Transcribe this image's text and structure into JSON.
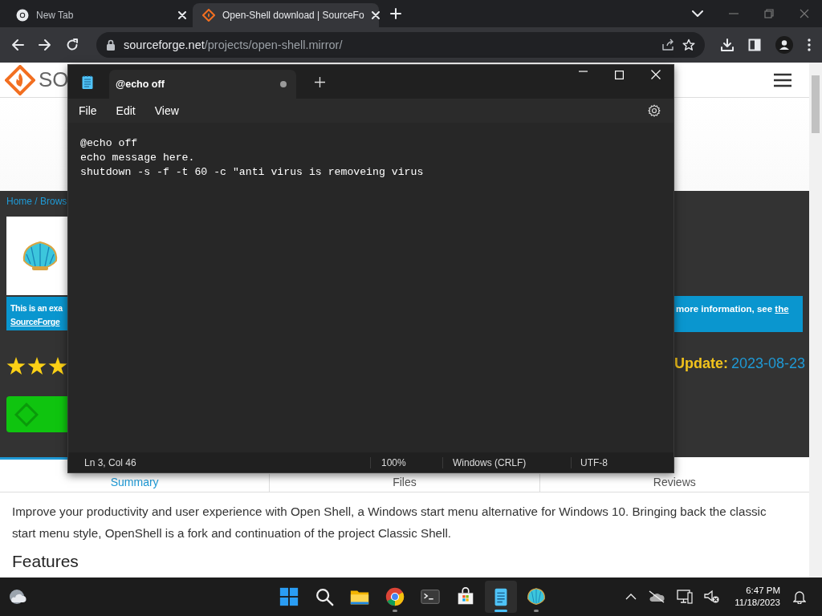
{
  "browser": {
    "tabs": [
      {
        "title": "New Tab",
        "kind": "chrome",
        "selected": false
      },
      {
        "title": "Open-Shell download | SourceFo",
        "kind": "sourceforge",
        "selected": true
      }
    ],
    "address": {
      "host": "sourceforge.net",
      "path": "/projects/open-shell.mirror/"
    }
  },
  "page": {
    "logo_text": "SO",
    "breadcrumb": "Home / Brows",
    "notice_left": [
      "This is an exa",
      "SourceForge"
    ],
    "stars": 3,
    "notice_right": {
      "text": "more information, see ",
      "link": "the"
    },
    "update": {
      "label": "Update:",
      "date": "2023-08-23"
    },
    "tabs": [
      {
        "label": "Summary",
        "selected": true
      },
      {
        "label": "Files",
        "selected": false
      },
      {
        "label": "Reviews",
        "selected": false
      }
    ],
    "description": "Improve your productivity and user experience with Open Shell, a Windows start menu alternative for Windows 10. Bringing back the classic start menu style, OpenShell is a fork and continuation of the project Classic Shell.",
    "heading": "Features"
  },
  "notepad": {
    "tab": {
      "title": "@echo off",
      "unsaved": true
    },
    "menu": [
      "File",
      "Edit",
      "View"
    ],
    "lines": [
      "@echo off",
      "echo message here.",
      "shutdown -s -f -t 60 -c \"anti virus is removeing virus"
    ],
    "status": [
      "Ln 3, Col 46",
      "100%",
      "Windows (CRLF)",
      "UTF-8"
    ]
  },
  "taskbar": {
    "apps": [
      {
        "kind": "start",
        "running": false,
        "active": false
      },
      {
        "kind": "search",
        "running": false,
        "active": false
      },
      {
        "kind": "files",
        "running": false,
        "active": false
      },
      {
        "kind": "chrome",
        "running": true,
        "active": false
      },
      {
        "kind": "terminal",
        "running": false,
        "active": false
      },
      {
        "kind": "store",
        "running": false,
        "active": false
      },
      {
        "kind": "notepad",
        "running": true,
        "active": true
      },
      {
        "kind": "shell",
        "running": true,
        "active": false
      }
    ],
    "time": "6:47 PM",
    "date": "11/18/2023"
  }
}
